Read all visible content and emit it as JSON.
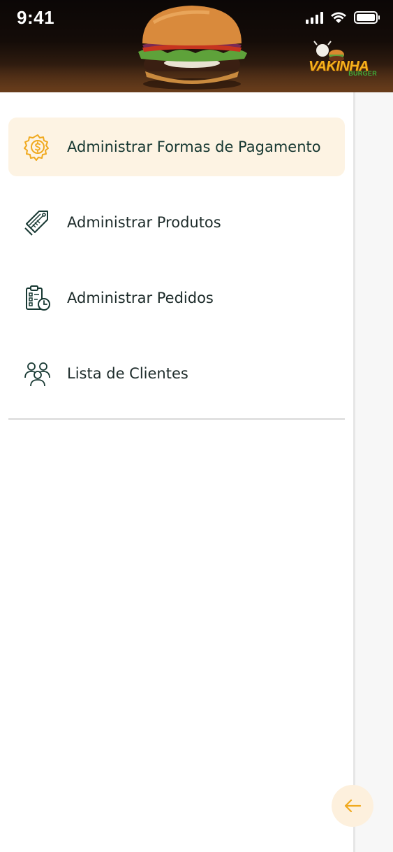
{
  "status_bar": {
    "time": "9:41"
  },
  "brand": {
    "name": "VAKINHA",
    "sub": "BURGER",
    "accent": "#f6b21b"
  },
  "menu": {
    "items": [
      {
        "label": "Administrar Formas de Pagamento",
        "icon": "payment-settings-icon",
        "active": true
      },
      {
        "label": "Administrar Produtos",
        "icon": "product-tag-icon",
        "active": false
      },
      {
        "label": "Administrar Pedidos",
        "icon": "orders-clipboard-icon",
        "active": false
      },
      {
        "label": "Lista de Clientes",
        "icon": "clients-group-icon",
        "active": false
      }
    ]
  },
  "fab": {
    "icon": "arrow-left-icon"
  },
  "colors": {
    "active_bg": "#fdf3e3",
    "icon_active": "#f0a91e",
    "icon_default": "#173832",
    "fab_bg": "#fdf0dd"
  }
}
